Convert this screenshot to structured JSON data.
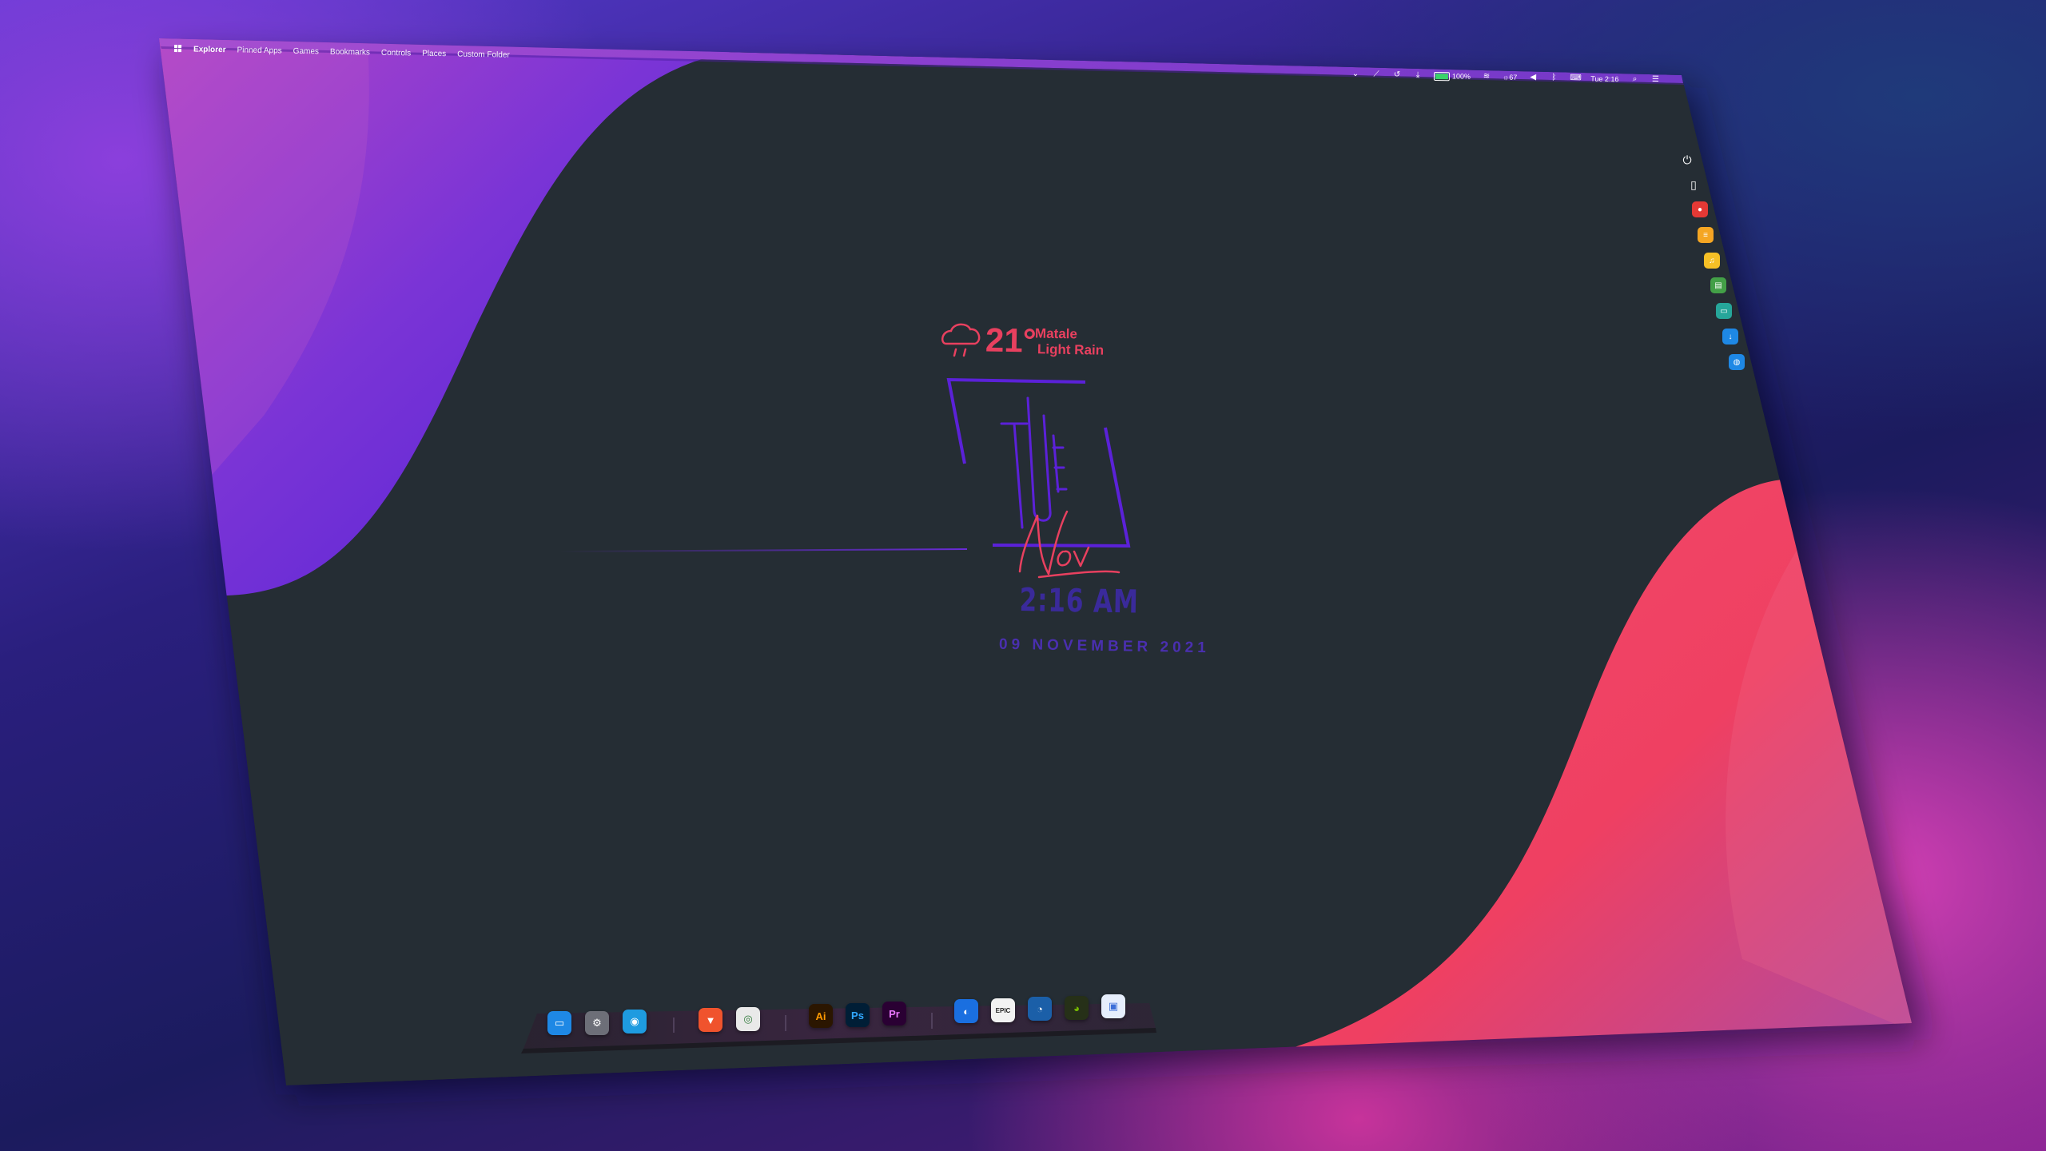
{
  "menubar": {
    "brand": "Explorer",
    "items": [
      "Pinned Apps",
      "Games",
      "Bookmarks",
      "Controls",
      "Places",
      "Custom Folder"
    ]
  },
  "tray": {
    "battery": "100%",
    "brightness": "67",
    "clock": "Tue 2:16"
  },
  "weather": {
    "temperature": "21°",
    "city": "Matale",
    "condition": "Light Rain"
  },
  "clock_widget": {
    "day": "Tue",
    "month": "Nov",
    "time": "2:16 AM",
    "date": "09 NOVEMBER 2021"
  },
  "dock": {
    "apps": [
      {
        "name": "finder-icon",
        "glyph": "▭",
        "color": "#1e88e5"
      },
      {
        "name": "settings-icon",
        "glyph": "⚙",
        "color": "#6d6f78"
      },
      {
        "name": "camera-icon",
        "glyph": "◉",
        "color": "#1e9be0"
      },
      {
        "name": "brave-icon",
        "glyph": "▼",
        "color": "#f0532d"
      },
      {
        "name": "chrome-icon",
        "glyph": "◎",
        "color": "#e9e9e9"
      },
      {
        "name": "illustrator-icon",
        "glyph": "Ai",
        "color": "#2b1600"
      },
      {
        "name": "photoshop-icon",
        "glyph": "Ps",
        "color": "#001e36"
      },
      {
        "name": "premiere-icon",
        "glyph": "Pr",
        "color": "#2a0033"
      },
      {
        "name": "uplay-icon",
        "glyph": "◐",
        "color": "#1a6fe0"
      },
      {
        "name": "epic-icon",
        "glyph": "EPIC",
        "color": "#f2f2f2"
      },
      {
        "name": "steam-icon",
        "glyph": "◔",
        "color": "#1b5fa8"
      },
      {
        "name": "nvidia-icon",
        "glyph": "◕",
        "color": "#263018"
      },
      {
        "name": "files-icon",
        "glyph": "▣",
        "color": "#e6eefc"
      }
    ]
  },
  "sidebar": {
    "items": [
      {
        "name": "power-icon",
        "glyph": "⏻",
        "color": "transparent"
      },
      {
        "name": "clipboard-icon",
        "glyph": "▯",
        "color": "transparent"
      },
      {
        "name": "record-icon",
        "glyph": "●",
        "color": "#e53935"
      },
      {
        "name": "notes-icon",
        "glyph": "≡",
        "color": "#f5a623"
      },
      {
        "name": "music-icon",
        "glyph": "♫",
        "color": "#f6c026"
      },
      {
        "name": "wallet-icon",
        "glyph": "▤",
        "color": "#43a047"
      },
      {
        "name": "window-icon",
        "glyph": "▭",
        "color": "#26a69a"
      },
      {
        "name": "download-icon",
        "glyph": "↓",
        "color": "#1e88e5"
      },
      {
        "name": "drop-icon",
        "glyph": "◍",
        "color": "#1e88e5"
      }
    ]
  },
  "colors": {
    "desktop": "#252d34",
    "accent_purple": "#5b21d8",
    "accent_pink": "#ef4062",
    "menubar": "#7a3cc8"
  }
}
